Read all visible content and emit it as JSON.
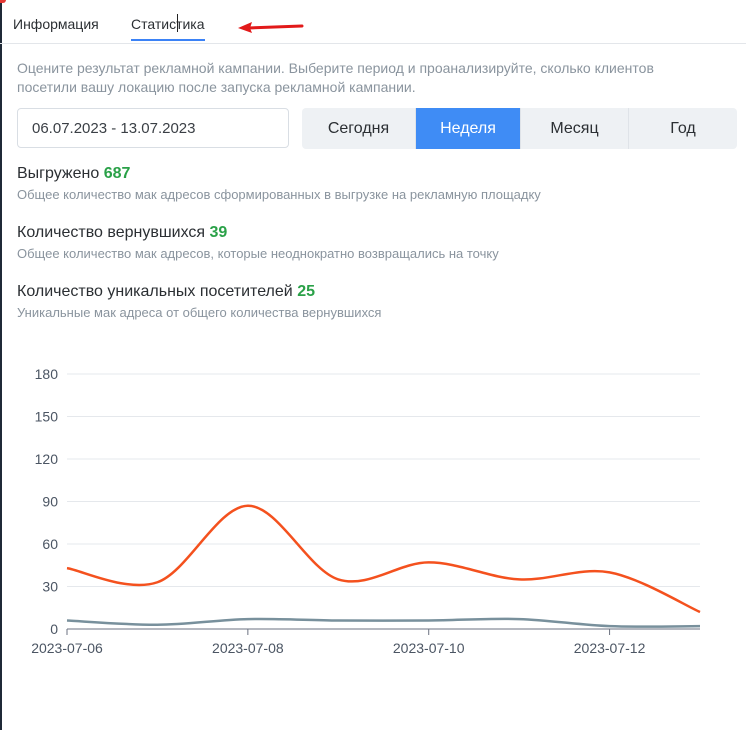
{
  "tabs": [
    {
      "label": "Информация"
    },
    {
      "label": "Статистика"
    }
  ],
  "description": "Оцените результат рекламной кампании. Выберите период и проанализируйте, сколько клиентов посетили вашу локацию после запуска рекламной кампании.",
  "date_range": {
    "value": "06.07.2023 - 13.07.2023"
  },
  "period_buttons": [
    {
      "label": "Сегодня"
    },
    {
      "label": "Неделя"
    },
    {
      "label": "Месяц"
    },
    {
      "label": "Год"
    }
  ],
  "stats": [
    {
      "title": "Выгружено",
      "value": "687",
      "subtitle": "Общее количество мак адресов сформированных в выгрузке на рекламную площадку"
    },
    {
      "title": "Количество вернувшихся",
      "value": "39",
      "subtitle": "Общее количество мак адресов, которые неоднократно возвращались на точку"
    },
    {
      "title": "Количество уникальных посетителей",
      "value": "25",
      "subtitle": "Уникальные мак адреса от общего количества вернувшихся"
    }
  ],
  "colors": {
    "accent": "#3f8cf5",
    "value_green": "#2aa148",
    "series_orange": "#f4511e",
    "series_gray": "#78909c",
    "arrow_red": "#e21a1a"
  },
  "chart_data": {
    "type": "line",
    "x": [
      "2023-07-06",
      "2023-07-07",
      "2023-07-08",
      "2023-07-09",
      "2023-07-10",
      "2023-07-11",
      "2023-07-12",
      "2023-07-13"
    ],
    "x_tick_labels": [
      "2023-07-06",
      "2023-07-08",
      "2023-07-10",
      "2023-07-12"
    ],
    "y_ticks": [
      0,
      30,
      60,
      90,
      120,
      150,
      180
    ],
    "ylim": [
      0,
      180
    ],
    "series": [
      {
        "values": [
          43,
          33,
          87,
          35,
          47,
          35,
          40,
          12
        ],
        "color": "#f4511e"
      },
      {
        "values": [
          6,
          3,
          7,
          6,
          6,
          7,
          2,
          2
        ],
        "color": "#78909c"
      }
    ],
    "grid": true,
    "smooth": true
  }
}
